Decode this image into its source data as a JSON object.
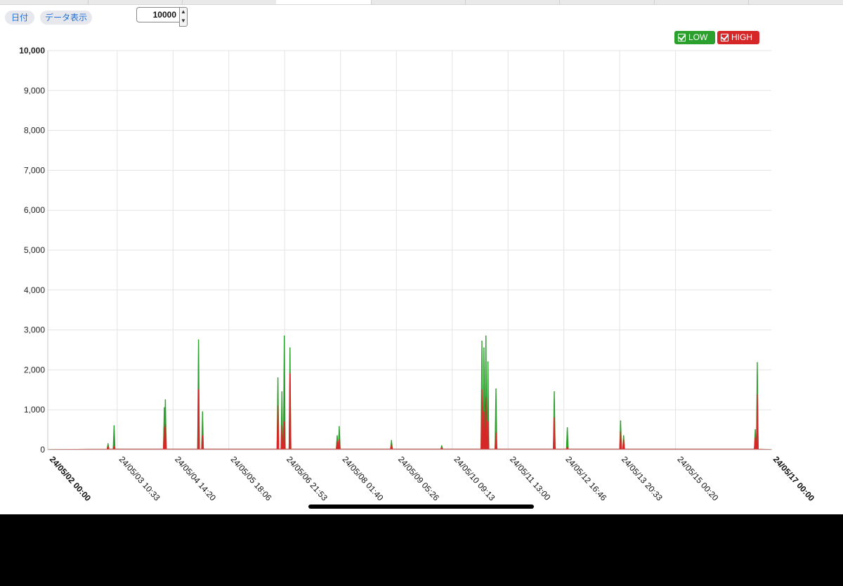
{
  "toolbar": {
    "date_button": "日付",
    "data_button": "データ表示",
    "max_value": "10000"
  },
  "legend": {
    "low_label": "LOW",
    "high_label": "HIGH"
  },
  "colors": {
    "low": "#2ca02c",
    "high": "#d62728",
    "grid": "#e3e3e3"
  },
  "chart_data": {
    "type": "area",
    "ylim": [
      0,
      10000
    ],
    "y_ticks": [
      "0",
      "1,000",
      "2,000",
      "3,000",
      "4,000",
      "5,000",
      "6,000",
      "7,000",
      "8,000",
      "9,000",
      "10,000"
    ],
    "x_tick_labels": [
      "24/05/02 00:00",
      "24/05/03 10:33",
      "24/05/04 14:20",
      "24/05/05 18:06",
      "24/05/06 21:53",
      "24/05/08 01:40",
      "24/05/09 05:26",
      "24/05/10 09:13",
      "24/05/11 13:00",
      "24/05/12 16:46",
      "24/05/13 20:33",
      "24/05/15 00:20",
      "24/05/17 00:00"
    ],
    "x_range": [
      "24/05/02 00:00",
      "24/05/17 00:00"
    ],
    "grid": true,
    "legend_position": "top-right",
    "series": [
      {
        "name": "LOW",
        "color": "#2ca02c",
        "peaks": [
          [
            "24/05/03 06:00",
            150
          ],
          [
            "24/05/03 09:00",
            600
          ],
          [
            "24/05/04 10:00",
            1050
          ],
          [
            "24/05/04 10:30",
            1250
          ],
          [
            "24/05/05 03:00",
            2750
          ],
          [
            "24/05/05 05:00",
            950
          ],
          [
            "24/05/06 18:30",
            1800
          ],
          [
            "24/05/06 20:30",
            1450
          ],
          [
            "24/05/06 21:40",
            2850
          ],
          [
            "24/05/07 00:30",
            2550
          ],
          [
            "24/05/08 00:00",
            350
          ],
          [
            "24/05/08 01:00",
            580
          ],
          [
            "24/05/09 03:00",
            230
          ],
          [
            "24/05/10 04:00",
            100
          ],
          [
            "24/05/11 00:00",
            2720
          ],
          [
            "24/05/11 01:00",
            2550
          ],
          [
            "24/05/11 02:00",
            2850
          ],
          [
            "24/05/11 03:00",
            2200
          ],
          [
            "24/05/11 07:00",
            1520
          ],
          [
            "24/05/12 12:00",
            1450
          ],
          [
            "24/05/12 18:30",
            550
          ],
          [
            "24/05/13 21:00",
            720
          ],
          [
            "24/05/13 22:30",
            350
          ],
          [
            "24/05/16 16:00",
            500
          ],
          [
            "24/05/16 17:00",
            2180
          ]
        ]
      },
      {
        "name": "HIGH",
        "color": "#d62728",
        "peaks": [
          [
            "24/05/03 06:00",
            80
          ],
          [
            "24/05/03 09:00",
            80
          ],
          [
            "24/05/04 10:00",
            550
          ],
          [
            "24/05/04 10:30",
            620
          ],
          [
            "24/05/05 03:00",
            1500
          ],
          [
            "24/05/05 05:00",
            350
          ],
          [
            "24/05/06 18:30",
            1100
          ],
          [
            "24/05/06 20:30",
            600
          ],
          [
            "24/05/06 21:40",
            700
          ],
          [
            "24/05/07 00:30",
            1900
          ],
          [
            "24/05/08 00:00",
            200
          ],
          [
            "24/05/08 01:00",
            250
          ],
          [
            "24/05/09 03:00",
            120
          ],
          [
            "24/05/10 04:00",
            40
          ],
          [
            "24/05/11 00:00",
            1500
          ],
          [
            "24/05/11 01:00",
            950
          ],
          [
            "24/05/11 02:00",
            1300
          ],
          [
            "24/05/11 03:00",
            700
          ],
          [
            "24/05/11 07:00",
            420
          ],
          [
            "24/05/12 12:00",
            800
          ],
          [
            "24/05/12 18:30",
            60
          ],
          [
            "24/05/13 21:00",
            450
          ],
          [
            "24/05/13 22:30",
            250
          ],
          [
            "24/05/16 16:00",
            300
          ],
          [
            "24/05/16 17:00",
            1380
          ]
        ]
      }
    ]
  }
}
